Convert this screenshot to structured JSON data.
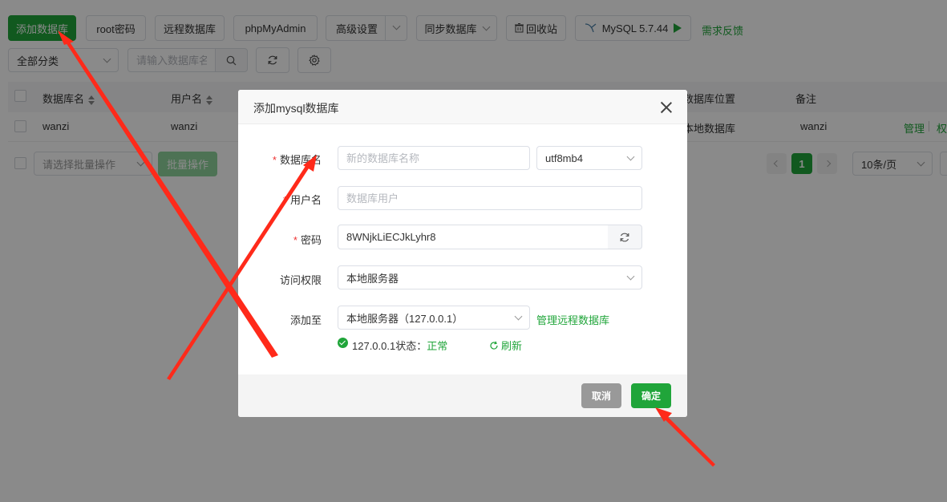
{
  "toolbar": {
    "add_db": "添加数据库",
    "root_pwd": "root密码",
    "remote_db": "远程数据库",
    "phpmyadmin": "phpMyAdmin",
    "advanced": "高级设置",
    "sync_db": "同步数据库",
    "recycle": "回收站",
    "mysql_version": "MySQL 5.7.44",
    "feedback": "需求反馈"
  },
  "filter": {
    "category": "全部分类",
    "search_placeholder": "请输入数据库名称"
  },
  "table": {
    "headers": {
      "db_name": "数据库名",
      "user_name": "用户名",
      "location": "数据库位置",
      "remark": "备注"
    },
    "row": {
      "db_name": "wanzi",
      "user_name": "wanzi",
      "location": "本地数据库",
      "remark": "wanzi",
      "manage": "管理",
      "perm": "权"
    }
  },
  "batch": {
    "select_placeholder": "请选择批量操作",
    "button": "批量操作"
  },
  "pagination": {
    "current_page": "1",
    "page_size": "10条/页"
  },
  "modal": {
    "title": "添加mysql数据库",
    "fields": {
      "db_name_label": "数据库名",
      "db_name_placeholder": "新的数据库名称",
      "charset": "utf8mb4",
      "user_label": "用户名",
      "user_placeholder": "数据库用户",
      "password_label": "密码",
      "password_value": "8WNjkLiECJkLyhr8",
      "access_label": "访问权限",
      "access_value": "本地服务器",
      "add_to_label": "添加至",
      "add_to_value": "本地服务器（127.0.0.1）",
      "manage_remote": "管理远程数据库",
      "status_text": "127.0.0.1状态：",
      "status_value": "正常",
      "refresh": "刷新"
    },
    "cancel": "取消",
    "confirm": "确定"
  },
  "colors": {
    "accent": "#20a53a",
    "annotation": "#ff2a1a"
  },
  "icons": [
    "search-icon",
    "refresh-icon",
    "gear-icon",
    "trash-icon",
    "mysql-logo-icon",
    "play-icon",
    "close-icon",
    "chevron-down-icon",
    "check-circle-icon",
    "chevron-left-icon",
    "chevron-right-icon"
  ]
}
